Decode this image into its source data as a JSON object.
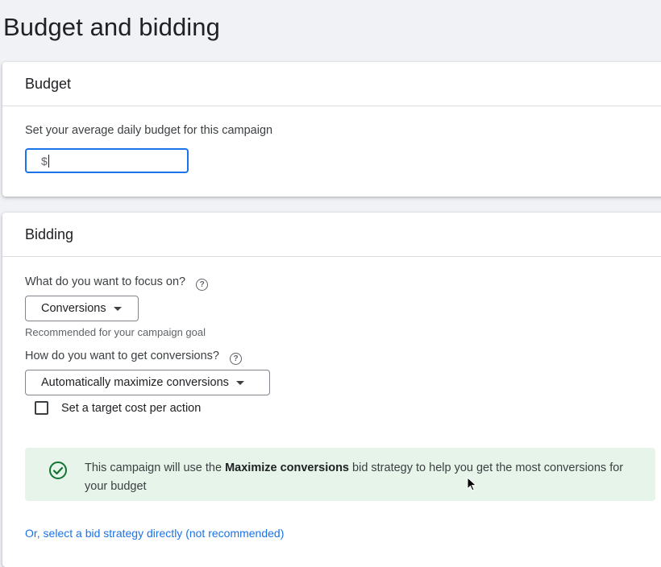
{
  "page": {
    "title": "Budget and bidding"
  },
  "budget": {
    "header": "Budget",
    "prompt": "Set your average daily budget for this campaign",
    "input_value": "$"
  },
  "bidding": {
    "header": "Bidding",
    "focus_question": "What do you want to focus on?",
    "focus_selected": "Conversions",
    "focus_hint": "Recommended for your campaign goal",
    "conversions_question": "How do you want to get conversions?",
    "conversions_selected": "Automatically maximize conversions",
    "target_cpa_label": "Set a target cost per action",
    "info": {
      "prefix": "This campaign will use the ",
      "strategy": "Maximize conversions",
      "suffix": " bid strategy to help you get the most conversions for your budget"
    },
    "select_strategy_link": "Or, select a bid strategy directly (not recommended)"
  },
  "icons": {
    "help": "help-circle-icon",
    "success": "check-circle-icon",
    "dropdown": "triangle-down-icon"
  },
  "colors": {
    "accent": "#1a73e8",
    "success_bg": "#e6f4ea",
    "success_icon": "#137333"
  }
}
